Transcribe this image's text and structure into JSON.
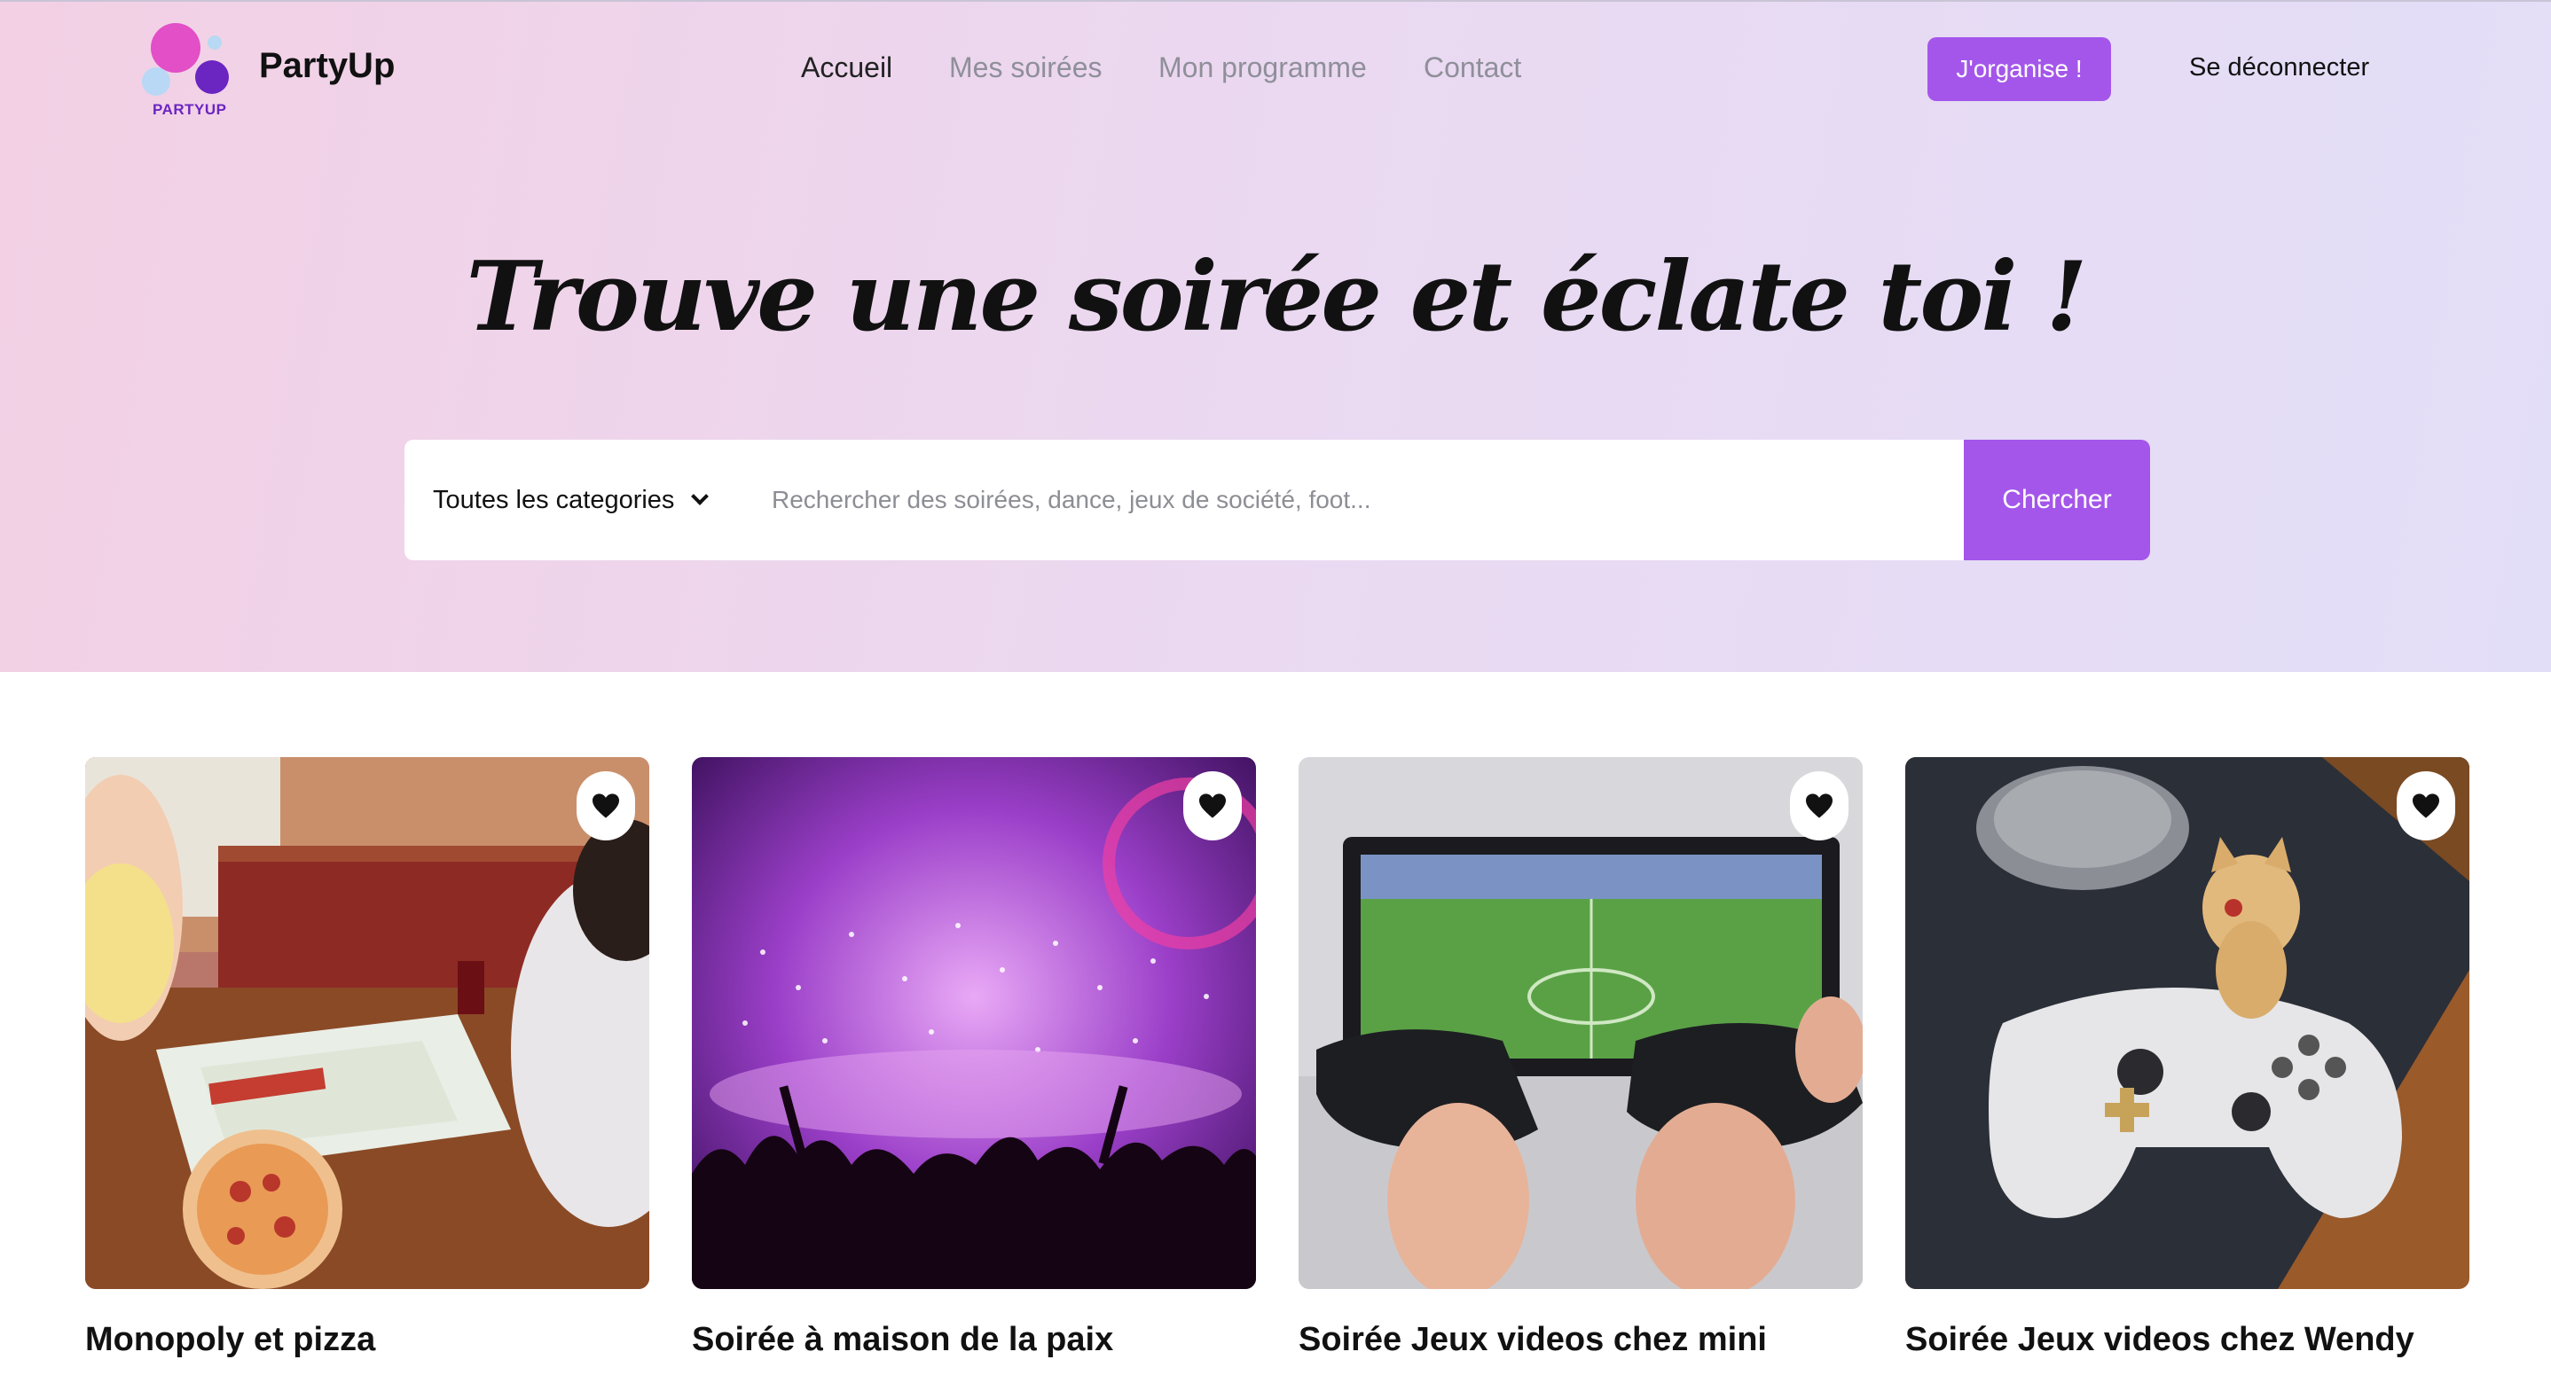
{
  "header": {
    "logo_text": "PARTYUP",
    "brand": "PartyUp",
    "nav": [
      "Accueil",
      "Mes soirées",
      "Mon programme",
      "Contact"
    ],
    "organize_label": "J'organise !",
    "logout_label": "Se déconnecter"
  },
  "hero": {
    "headline": "Trouve une soirée et éclate toi !",
    "category_label": "Toutes les categories",
    "search_placeholder": "Rechercher des soirées, dance, jeux de société, foot...",
    "search_button": "Chercher"
  },
  "cards": [
    {
      "title": "Monopoly et pizza",
      "favorite_icon": "heart-icon"
    },
    {
      "title": "Soirée à maison de la paix",
      "favorite_icon": "heart-icon"
    },
    {
      "title": "Soirée Jeux videos chez mini",
      "favorite_icon": "heart-icon"
    },
    {
      "title": "Soirée Jeux videos chez Wendy",
      "favorite_icon": "heart-icon"
    }
  ],
  "colors": {
    "accent": "#a456ea",
    "logo_pink": "#e24fc7",
    "logo_purple": "#6b25c1",
    "logo_blue": "#b9d8f6"
  }
}
